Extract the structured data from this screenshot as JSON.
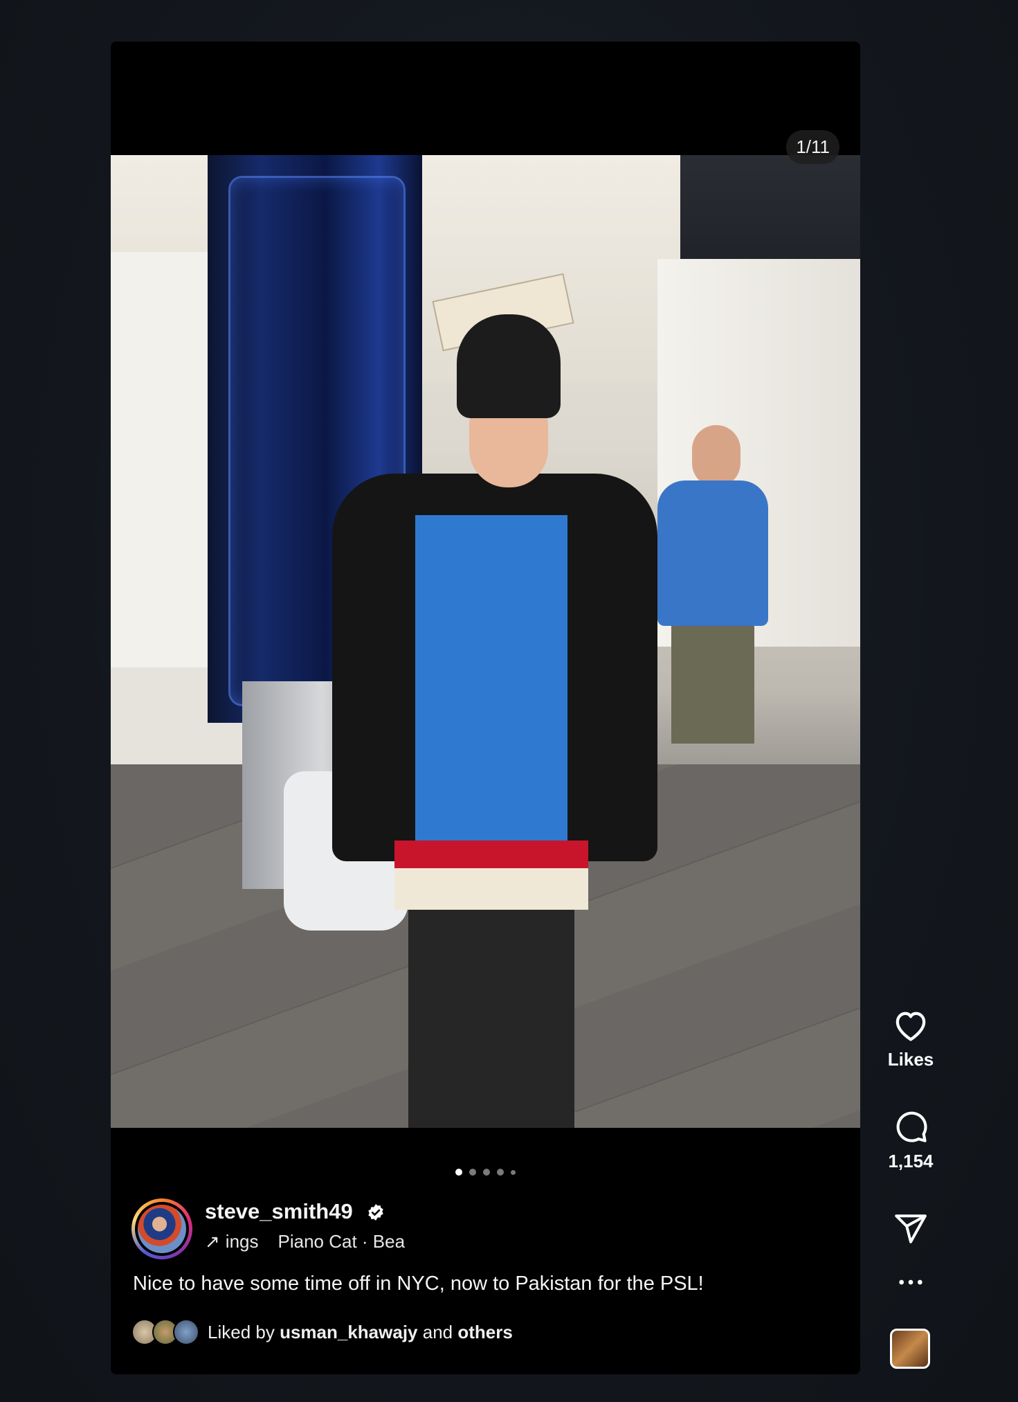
{
  "post": {
    "counter": "1/11",
    "author": {
      "username": "steve_smith49",
      "verified": true
    },
    "music": {
      "artist_partial": "ings",
      "track_partial": "Piano Cat · Bea"
    },
    "caption": "Nice to have some time off in NYC, now to Pakistan for the PSL!",
    "liked_by": {
      "prefix": "Liked by",
      "user": "usman_khawajy",
      "conjunction": "and",
      "others": "others"
    },
    "carousel": {
      "total_dots": 5,
      "active_index": 0
    }
  },
  "actions": {
    "likes_label": "Likes",
    "comments_count": "1,154",
    "like_icon": "heart-icon",
    "comment_icon": "comment-icon",
    "share_icon": "share-icon",
    "more_icon": "more-icon"
  },
  "colors": {
    "background": "#13171d",
    "post_background": "#000000",
    "verified_badge": "#ffffff",
    "dot_active": "#ffffff",
    "dot_inactive": "#7a7a7a"
  }
}
